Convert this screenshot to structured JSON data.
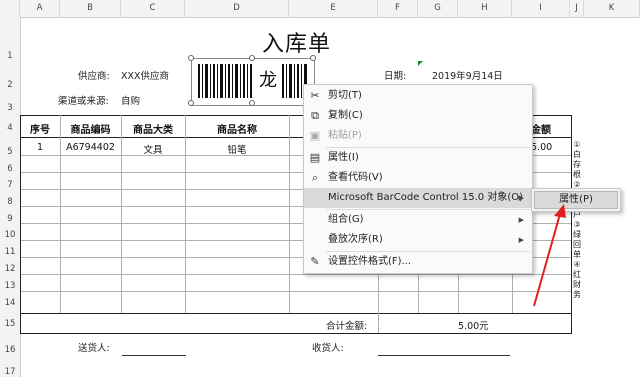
{
  "columns": [
    "A",
    "B",
    "C",
    "D",
    "E",
    "F",
    "G",
    "H",
    "I",
    "J",
    "K"
  ],
  "rows": [
    "1",
    "2",
    "3",
    "4",
    "5",
    "6",
    "7",
    "8",
    "9",
    "10",
    "11",
    "12",
    "13",
    "14",
    "15",
    "16",
    "17"
  ],
  "form": {
    "title": "入库单",
    "supplier_label": "供应商:",
    "supplier_value": "XXX供应商",
    "channel_label": "渠道或来源:",
    "channel_value": "自购",
    "date_label": "日期:",
    "date_value": "2019年9月14日",
    "barcode_char": "龙",
    "headers": [
      "序号",
      "商品编码",
      "商品大类",
      "商品名称",
      "金额"
    ],
    "row": {
      "no": "1",
      "code": "A6794402",
      "category": "文具",
      "name": "铅笔",
      "amount": "5.00"
    },
    "total_label": "合计金额:",
    "total_value": "5.00元",
    "sender_label": "送货人:",
    "receiver_label": "收货人:",
    "side_notes": [
      "①",
      "白",
      "存",
      "根",
      "②",
      "黄",
      "供",
      "应",
      "商",
      "③",
      "客",
      "户",
      "③",
      "绿",
      "回",
      "单",
      "④",
      "红",
      "财",
      "务"
    ]
  },
  "context_menu": {
    "items": [
      {
        "label": "剪切(T)",
        "icon": "scissors-icon",
        "glyph": "✂"
      },
      {
        "label": "复制(C)",
        "icon": "copy-icon",
        "glyph": "⧉"
      },
      {
        "label": "粘贴(P)",
        "icon": "paste-icon",
        "glyph": "📋",
        "disabled": true
      },
      {
        "label": "属性(I)",
        "icon": "properties-icon",
        "glyph": "▤"
      },
      {
        "label": "查看代码(V)",
        "icon": "view-code-icon",
        "glyph": "⌕"
      },
      {
        "label": "Microsoft BarCode Control 15.0 对象(O)",
        "icon": "",
        "glyph": "",
        "submenu": true,
        "highlighted": true
      },
      {
        "label": "组合(G)",
        "icon": "",
        "glyph": "",
        "submenu": true
      },
      {
        "label": "叠放次序(R)",
        "icon": "",
        "glyph": "",
        "submenu": true
      },
      {
        "label": "设置控件格式(F)...",
        "icon": "format-control-icon",
        "glyph": "✎"
      }
    ],
    "submenu_item": "属性(P)"
  },
  "colors": {
    "arrow": "#e02020",
    "menu_highlight": "#dadada"
  }
}
